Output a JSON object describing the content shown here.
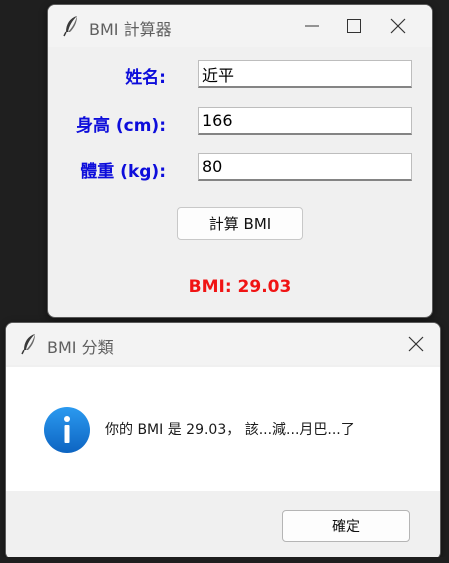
{
  "main_window": {
    "title": "BMI 計算器",
    "name_label": "姓名:",
    "name_value": "近平",
    "height_label": "身高 (cm):",
    "height_value": "166",
    "weight_label": "體重 (kg):",
    "weight_value": "80",
    "calc_button": "計算 BMI",
    "result_text": "BMI: 29.03"
  },
  "dialog": {
    "title": "BMI 分類",
    "message": "你的 BMI 是 29.03， 該...減...月巴...了",
    "ok_button": "確定"
  },
  "colors": {
    "label_blue": "#0d0ddb",
    "result_red": "#f01414",
    "info_blue": "#1a7fd6"
  }
}
